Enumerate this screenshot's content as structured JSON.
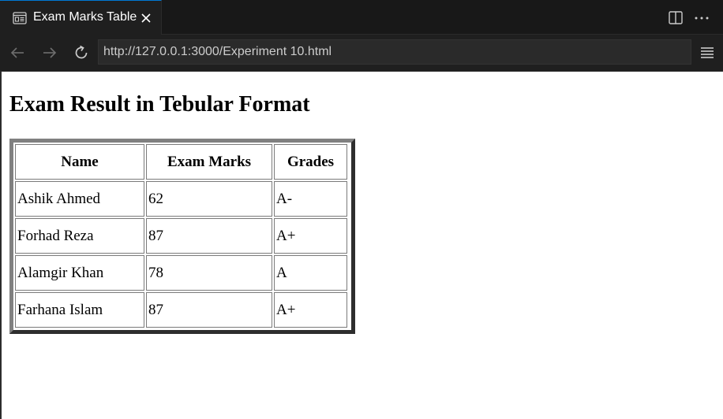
{
  "tab": {
    "title": "Exam Marks Table",
    "icon": "preview-icon"
  },
  "toolbar": {
    "icons": [
      "split-editor-icon",
      "more-actions-icon"
    ]
  },
  "nav": {
    "url": "http://127.0.0.1:3000/Experiment 10.html"
  },
  "page": {
    "title": "Exam Result in Tebular Format",
    "table": {
      "headers": [
        "Name",
        "Exam Marks",
        "Grades"
      ],
      "rows": [
        [
          "Ashik Ahmed",
          "62",
          "A-"
        ],
        [
          "Forhad Reza",
          "87",
          "A+"
        ],
        [
          "Alamgir Khan",
          "78",
          "A"
        ],
        [
          "Farhana Islam",
          "87",
          "A+"
        ]
      ]
    }
  },
  "colors": {
    "accent": "#0078d4",
    "chrome_bg": "#1f1f1f",
    "tabbar_bg": "#181818"
  }
}
